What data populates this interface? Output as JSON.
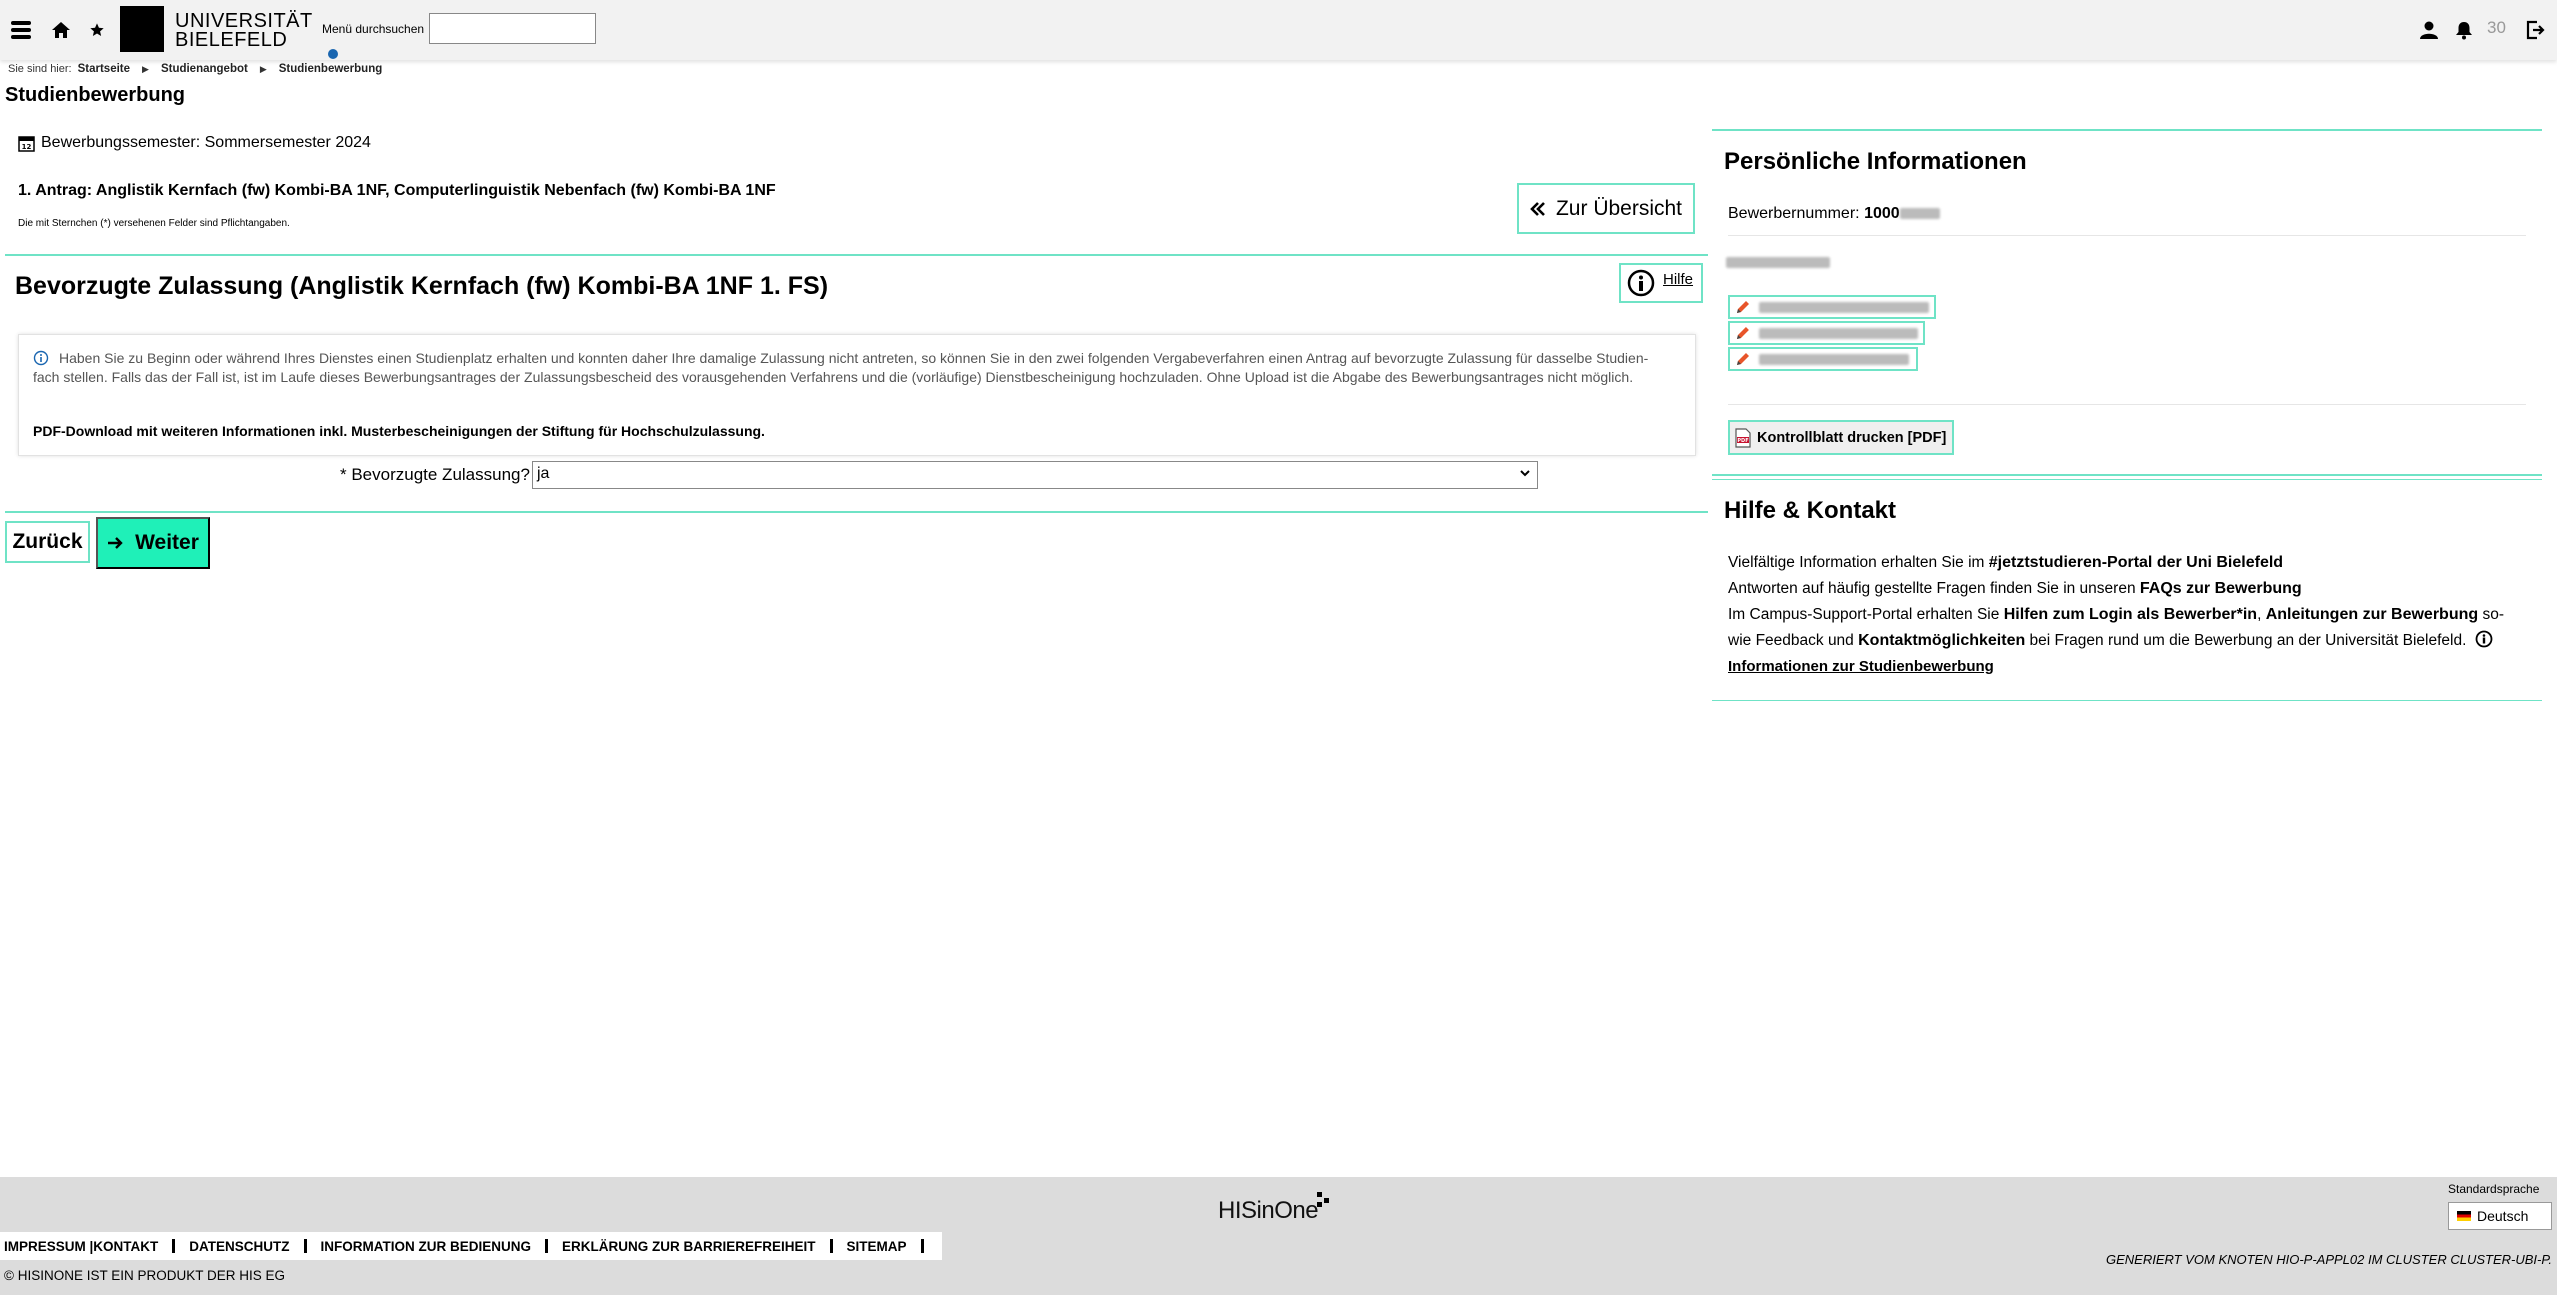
{
  "header": {
    "logo_line1": "UNIVERSITÄT",
    "logo_line2": "BIELEFELD",
    "search_label": "Menü durchsuchen",
    "search_value": "",
    "count": "30"
  },
  "breadcrumb": {
    "prefix": "Sie sind hier:",
    "items": [
      "Startseite",
      "Studienangebot",
      "Studienbewerbung"
    ]
  },
  "page_title": "Studienbewerbung",
  "main": {
    "semester": "Bewerbungssemester: Sommersemester 2024",
    "antrag": "1. Antrag: Anglistik Kernfach (fw) Kombi-BA 1NF, Computerlinguistik Nebenfach (fw) Kombi-BA 1NF",
    "pflicht": "Die mit Sternchen (*) versehenen Felder sind Pflichtangaben.",
    "overview_button": "Zur Übersicht",
    "section_title": "Bevorzugte Zulassung (Anglistik Kernfach (fw) Kombi-BA 1NF 1. FS)",
    "help_button": "Hilfe",
    "info_line1": "Haben Sie zu Beginn oder während Ihres Dienstes einen Studienplatz erhalten und konnten daher Ihre damalige Zulassung nicht antreten, so können Sie in den zwei folgenden Vergabeverfahren einen Antrag auf bevorzugte Zulassung für dasselbe Studien-",
    "info_line2": "fach stellen. Falls das der Fall ist, ist im Laufe dieses Bewerbungsantrages der Zulassungsbescheid des vorausgehenden Verfahrens und die (vorläufige) Dienstbescheinigung hochzuladen. Ohne Upload ist die Abgabe des Bewerbungsantrages nicht möglich.",
    "pdf_link": "PDF-Download mit weiteren Informationen inkl. Musterbescheinigungen der Stiftung für Hochschulzulassung.",
    "field_label": "* Bevorzugte Zulassung?",
    "field_value": "ja",
    "back_button": "Zurück",
    "next_button": "Weiter"
  },
  "personal": {
    "title": "Persönliche Informationen",
    "applicant_label": "Bewerbernummer:",
    "applicant_number": "1000",
    "print_button": "Kontrollblatt drucken [PDF]"
  },
  "help_contact": {
    "title": "Hilfe & Kontakt",
    "t1": "Vielfältige Information erhalten Sie im ",
    "l1": "#jetztstudieren-Portal der Uni Bielefeld",
    "t2": "Antworten auf häufig gestellte Fragen finden Sie in unseren ",
    "l2": "FAQs zur Bewerbung",
    "t3": "Im Campus-Support-Portal erhalten Sie ",
    "l3": "Hilfen zum Login als Bewerber*in",
    "l4": "Anleitungen zur Bewerbung",
    "t4": " so-",
    "t5": "wie Feedback und ",
    "l5": "Kontaktmöglichkeiten",
    "t6": " bei Fragen rund um die Bewerbung an der Universität Bielefeld.",
    "l6": "Informationen zur Studienbewerbung"
  },
  "footer": {
    "logo": "HISinOne",
    "links": [
      "IMPRESSUM |KONTAKT",
      "DATENSCHUTZ",
      "INFORMATION ZUR BEDIENUNG",
      "ERKLÄRUNG ZUR BARRIEREFREIHEIT",
      "SITEMAP"
    ],
    "copyright": "© HISINONE IST EIN PRODUKT DER HIS EG",
    "language_label": "Standardsprache",
    "language": "Deutsch",
    "generated": "GENERIERT VOM KNOTEN HIO-P-APPL02 IM CLUSTER CLUSTER-UBI-P."
  },
  "colors": {
    "accent": "#1ff0b8",
    "accent_line": "#6fe3c6",
    "edit_icon": "#e8552a"
  }
}
